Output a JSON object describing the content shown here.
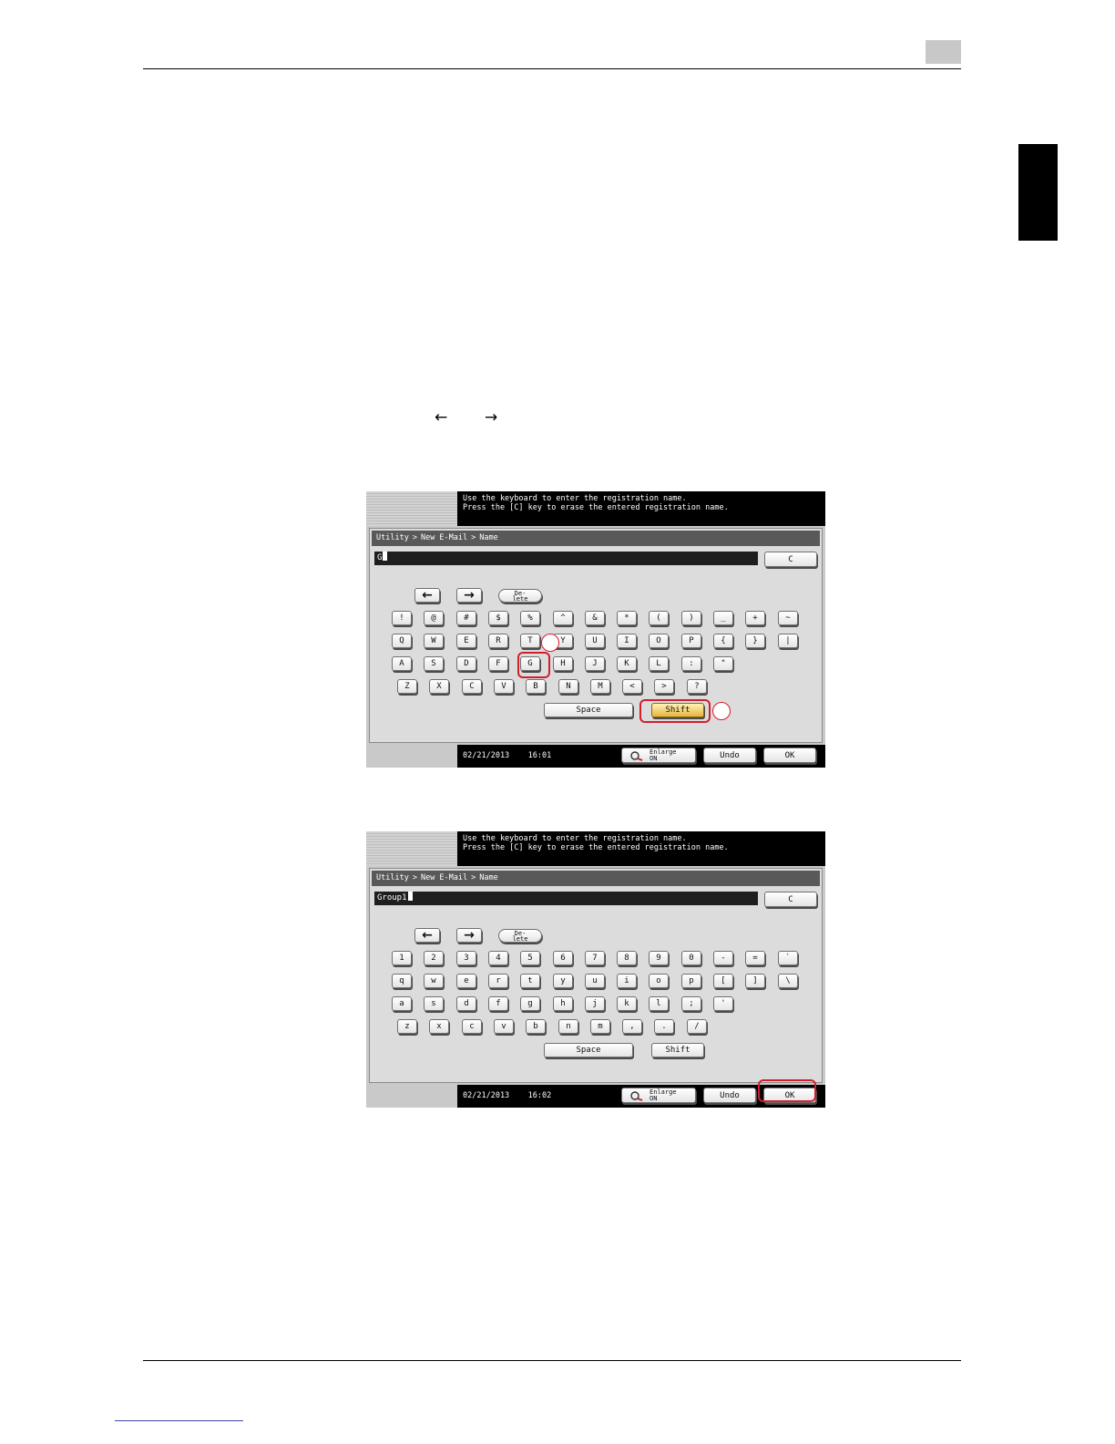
{
  "page": {
    "arrow_left": "←",
    "arrow_right": "→"
  },
  "screen1": {
    "message_line1": "Use the keyboard to enter the registration name.",
    "message_line2": "Press the [C] key to erase the entered registration name.",
    "breadcrumb": [
      "Utility",
      "New E-Mail",
      "Name"
    ],
    "breadcrumb_sep": ">",
    "input_value": "G",
    "clear_label": "C",
    "nav_left": "←",
    "nav_right": "→",
    "delete_line1": "De-",
    "delete_line2": "lete",
    "rows": [
      [
        "!",
        "@",
        "#",
        "$",
        "%",
        "^",
        "&",
        "*",
        "(",
        ")",
        "_",
        "+",
        "~"
      ],
      [
        "Q",
        "W",
        "E",
        "R",
        "T",
        "Y",
        "U",
        "I",
        "O",
        "P",
        "{",
        "}",
        "|"
      ],
      [
        "A",
        "S",
        "D",
        "F",
        "G",
        "H",
        "J",
        "K",
        "L",
        ":",
        "\""
      ],
      [
        "Z",
        "X",
        "C",
        "V",
        "B",
        "N",
        "M",
        "<",
        ">",
        "?"
      ]
    ],
    "space_label": "Space",
    "shift_label": "Shift",
    "date": "02/21/2013",
    "time": "16:01",
    "enlarge_line1": "Enlarge",
    "enlarge_line2": "ON",
    "undo_label": "Undo",
    "ok_label": "OK"
  },
  "screen2": {
    "message_line1": "Use the keyboard to enter the registration name.",
    "message_line2": "Press the [C] key to erase the entered registration name.",
    "breadcrumb": [
      "Utility",
      "New E-Mail",
      "Name"
    ],
    "breadcrumb_sep": ">",
    "input_value": "Group1",
    "clear_label": "C",
    "nav_left": "←",
    "nav_right": "→",
    "delete_line1": "De-",
    "delete_line2": "lete",
    "rows": [
      [
        "1",
        "2",
        "3",
        "4",
        "5",
        "6",
        "7",
        "8",
        "9",
        "0",
        "-",
        "=",
        "`"
      ],
      [
        "q",
        "w",
        "e",
        "r",
        "t",
        "y",
        "u",
        "i",
        "o",
        "p",
        "[",
        "]",
        "\\"
      ],
      [
        "a",
        "s",
        "d",
        "f",
        "g",
        "h",
        "j",
        "k",
        "l",
        ";",
        "'"
      ],
      [
        "z",
        "x",
        "c",
        "v",
        "b",
        "n",
        "m",
        ",",
        ".",
        "/"
      ]
    ],
    "space_label": "Space",
    "shift_label": "Shift",
    "date": "02/21/2013",
    "time": "16:02",
    "enlarge_line1": "Enlarge",
    "enlarge_line2": "ON",
    "undo_label": "Undo",
    "ok_label": "OK"
  },
  "colors": {
    "highlight": "#d21f2c",
    "shift_active": "#e7b53c"
  }
}
